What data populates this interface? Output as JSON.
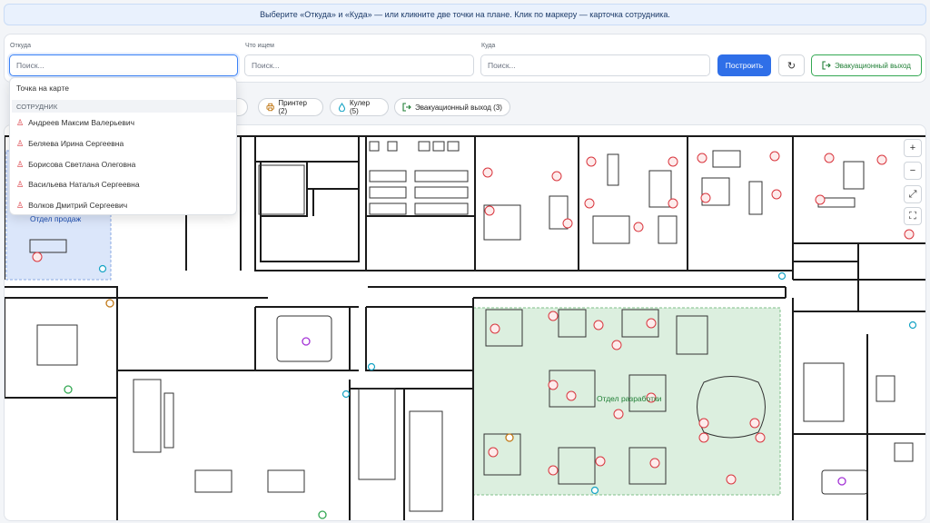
{
  "hint": "Выберите «Откуда» и «Куда» — или кликните две точки на плане. Клик по маркеру — карточка сотрудника.",
  "from": {
    "label": "Откуда",
    "placeholder": "Поиск..."
  },
  "what": {
    "label": "Что ищем",
    "placeholder": "Поиск..."
  },
  "to": {
    "label": "Куда",
    "placeholder": "Поиск..."
  },
  "build_label": "Построить",
  "reset_icon": "↻",
  "evac_label": "Эвакуационный выход",
  "chips": [
    {
      "icon": "printer-icon",
      "glyph": "🖶",
      "label": "Принтер (2)"
    },
    {
      "icon": "cooler-icon",
      "glyph": "💧",
      "label": "Кулер (5)"
    },
    {
      "icon": "exit-icon",
      "glyph": "⇥",
      "label": "Эвакуационный выход (3)"
    }
  ],
  "chip_hidden_count": "2)",
  "dropdown": {
    "map_point": "Точка на карте",
    "group": "СОТРУДНИК",
    "employees": [
      "Андреев Максим Валерьевич",
      "Беляева Ирина Сергеевна",
      "Борисова Светлана Олеговна",
      "Васильева Наталья Сергеевна",
      "Волков Дмитрий Сергеевич"
    ]
  },
  "rooms": {
    "sales": "Отдел продаж",
    "dev": "Отдел разработки"
  },
  "zoom": {
    "in": "+",
    "out": "−",
    "fit": "⤢",
    "full": "⛶"
  },
  "colors": {
    "accent": "#2f6fe8",
    "evac": "#34a853",
    "marker": "#d9363e",
    "cooler": "#16a3c4",
    "printer": "#c27a1a",
    "meeting": "#a332d6"
  }
}
